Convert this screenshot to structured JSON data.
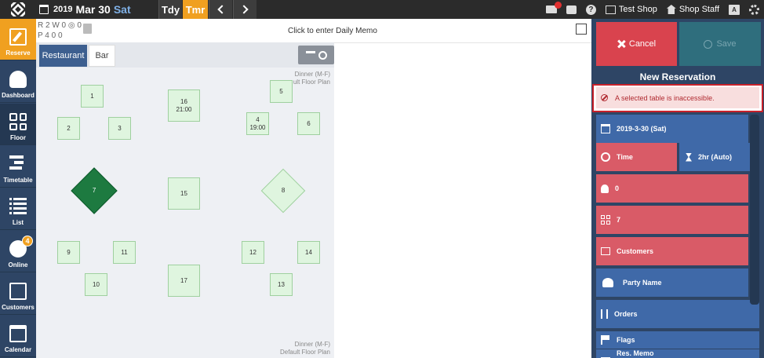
{
  "topbar": {
    "year": "2019",
    "month_day": "Mar 30",
    "weekday": "Sat",
    "today_label": "Tdy",
    "tomorrow_label": "Tmr",
    "shop_label": "Test Shop",
    "staff_label": "Shop Staff",
    "lang_label": "A"
  },
  "sidebar": {
    "items": [
      {
        "label": "Reserve"
      },
      {
        "label": "Dashboard"
      },
      {
        "label": "Floor"
      },
      {
        "label": "Timetable"
      },
      {
        "label": "List"
      },
      {
        "label": "Online",
        "badge": "4"
      },
      {
        "label": "Customers"
      },
      {
        "label": "Calendar"
      }
    ]
  },
  "stats": {
    "line1": "R 2 W 0 ◎ 0",
    "line2": "P 4    0    0"
  },
  "memo": {
    "label": "Click to enter Daily Memo"
  },
  "floor": {
    "tabs": [
      {
        "label": "Restaurant"
      },
      {
        "label": "Bar"
      }
    ],
    "plan_label_top_1": "Dinner (M-F)",
    "plan_label_top_2": "ult Floor Plan",
    "plan_label_bottom_1": "Dinner (M-F)",
    "plan_label_bottom_2": "Default Floor Plan",
    "tables": [
      {
        "num": "1",
        "time": ""
      },
      {
        "num": "2",
        "time": ""
      },
      {
        "num": "3",
        "time": ""
      },
      {
        "num": "16",
        "time": "21:00"
      },
      {
        "num": "4",
        "time": "19:00"
      },
      {
        "num": "5",
        "time": ""
      },
      {
        "num": "6",
        "time": ""
      },
      {
        "num": "7",
        "time": ""
      },
      {
        "num": "15",
        "time": ""
      },
      {
        "num": "8",
        "time": ""
      },
      {
        "num": "9",
        "time": ""
      },
      {
        "num": "11",
        "time": ""
      },
      {
        "num": "12",
        "time": ""
      },
      {
        "num": "14",
        "time": ""
      },
      {
        "num": "10",
        "time": ""
      },
      {
        "num": "17",
        "time": ""
      },
      {
        "num": "13",
        "time": ""
      }
    ]
  },
  "panel": {
    "cancel_label": "Cancel",
    "save_label": "Save",
    "title": "New Reservation",
    "error": "A selected table is inaccessible.",
    "date": "2019-3-30 (Sat)",
    "time_label": "Time",
    "duration": "2hr (Auto)",
    "guests": "0",
    "table": "7",
    "customers_label": "Customers",
    "party_label": "Party Name",
    "orders_label": "Orders",
    "flags_label": "Flags",
    "memo_label": "Res. Memo"
  },
  "colors": {
    "accent": "#f0a020",
    "navy": "#2e4565",
    "row_blue": "#3f69a8",
    "row_red": "#d95b67",
    "cancel": "#d9434e",
    "selected_table": "#1d7a40",
    "error_border": "#c8212a"
  }
}
